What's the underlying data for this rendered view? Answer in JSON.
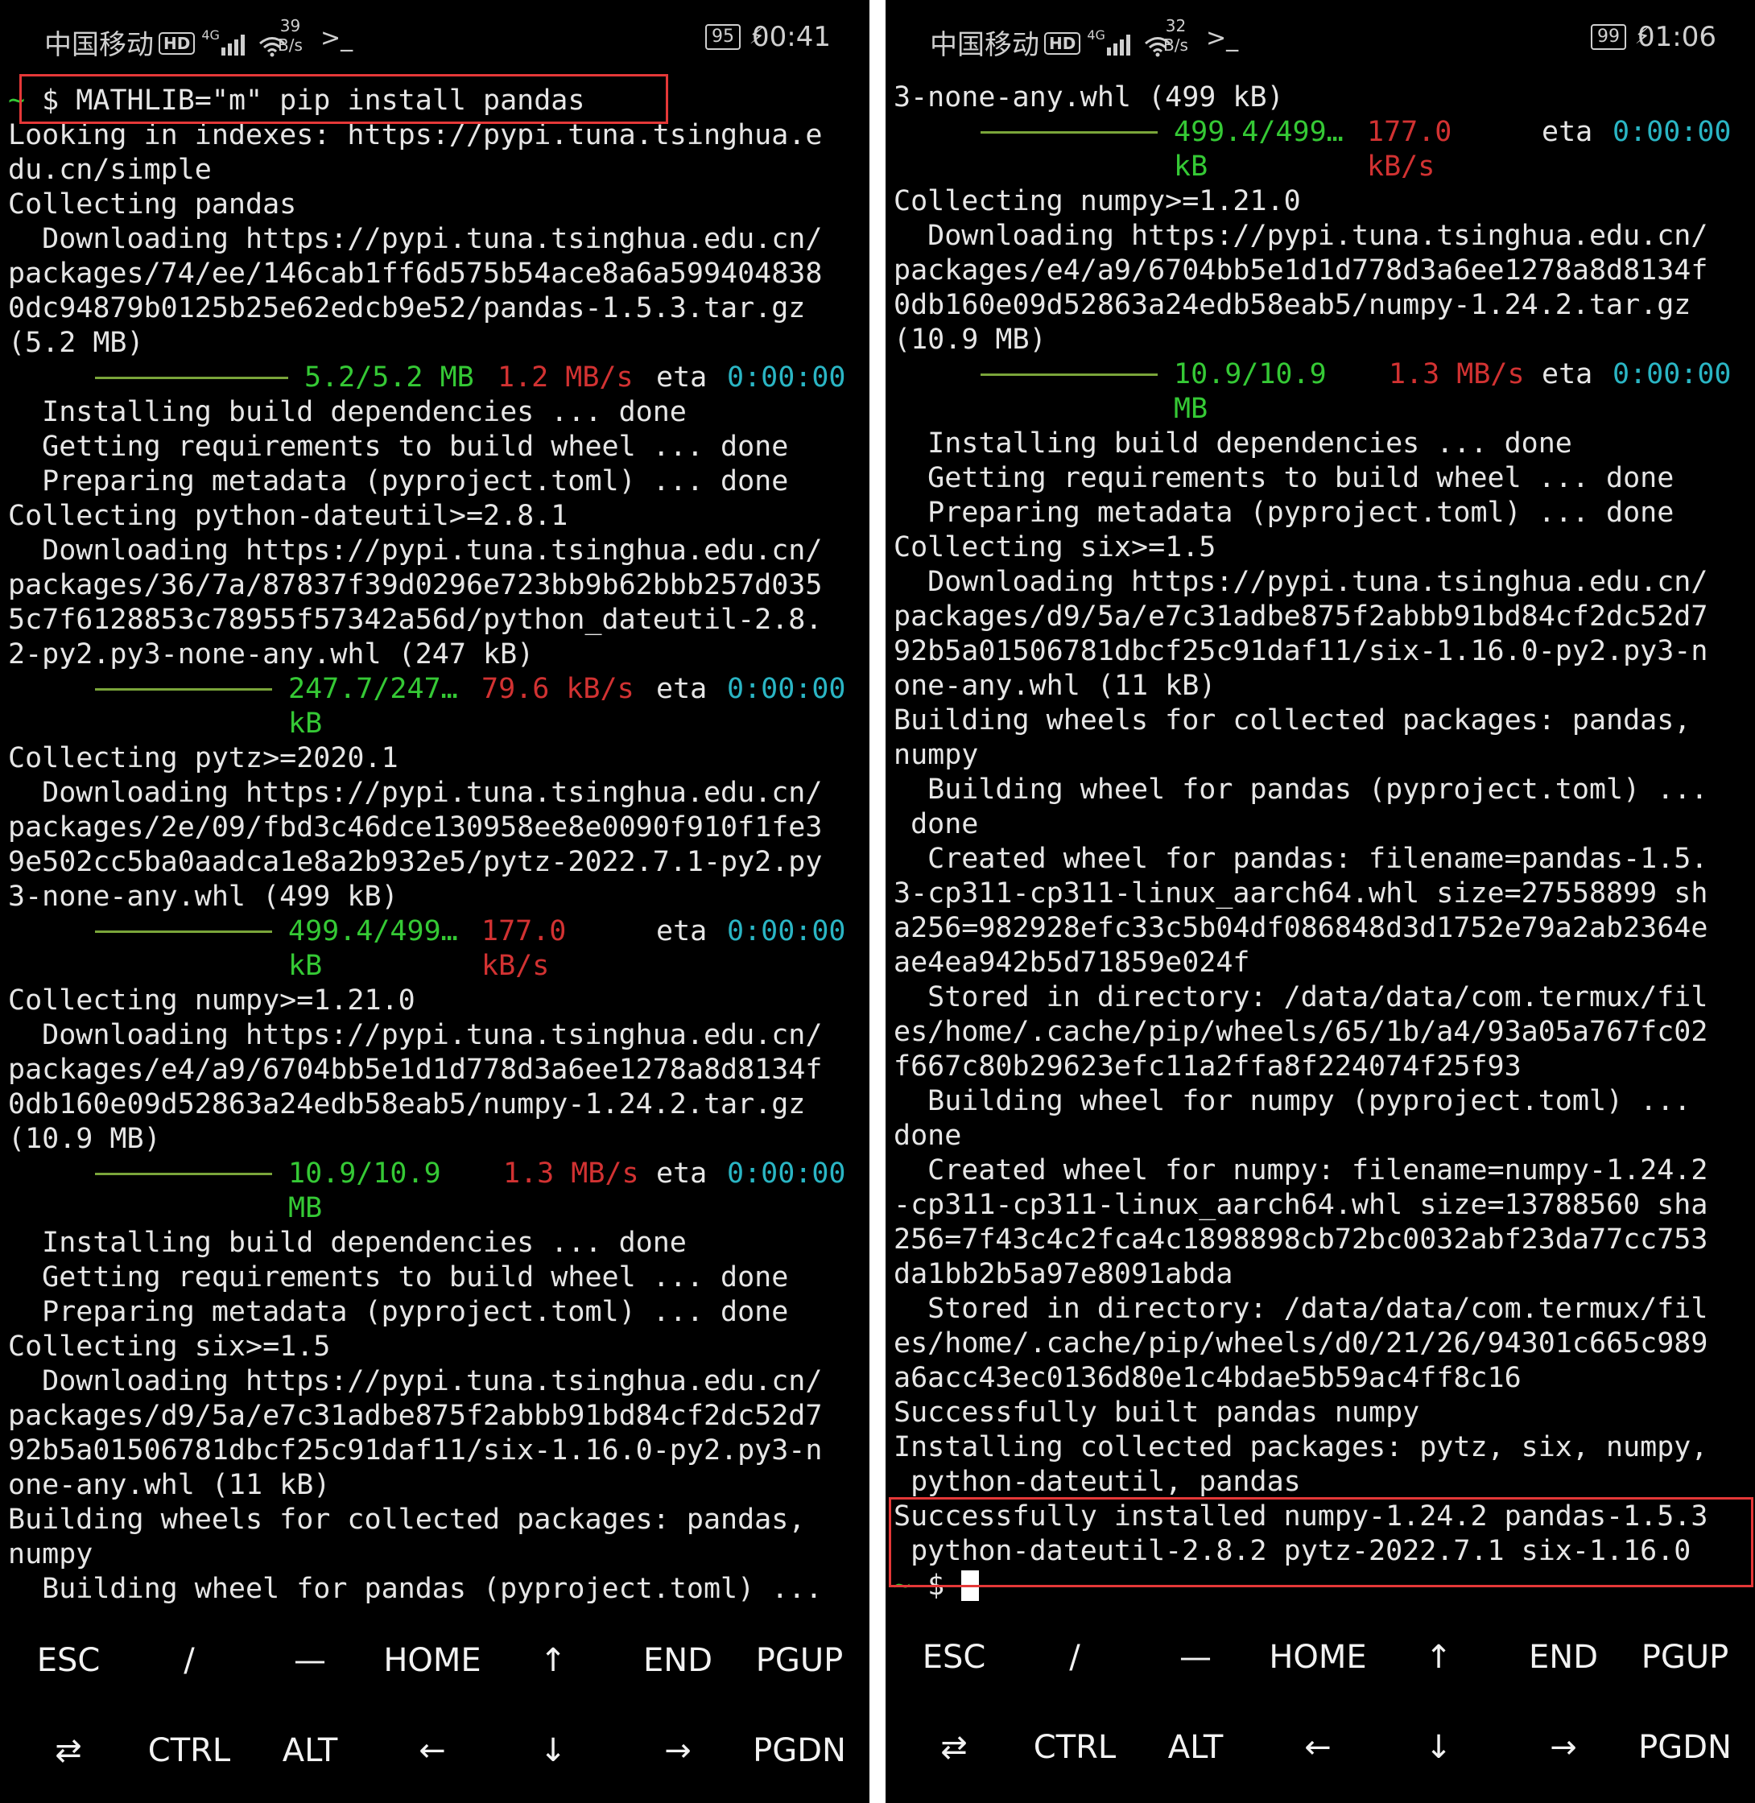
{
  "left": {
    "status": {
      "carrier": "中国移动",
      "hd": "HD",
      "signal": "4G",
      "speed_value": "39",
      "speed_unit": "B/s",
      "battery": "95",
      "time": "00:41"
    },
    "command": "$ MATHLIB=\"m\" pip install pandas",
    "prompt_tilde": "~",
    "lines": [
      "Looking in indexes: https://pypi.tuna.tsinghua.e",
      "du.cn/simple",
      "Collecting pandas",
      "  Downloading https://pypi.tuna.tsinghua.edu.cn/",
      "packages/74/ee/146cab1ff6d575b54ace8a6a599404838",
      "0dc94879b0125b25e62edcb9e52/pandas-1.5.3.tar.gz",
      "(5.2 MB)",
      "  Installing build dependencies ... done",
      "  Getting requirements to build wheel ... done",
      "  Preparing metadata (pyproject.toml) ... done",
      "Collecting python-dateutil>=2.8.1",
      "  Downloading https://pypi.tuna.tsinghua.edu.cn/",
      "packages/36/7a/87837f39d0296e723bb9b62bbb257d035",
      "5c7f6128853c78955f57342a56d/python_dateutil-2.8.",
      "2-py2.py3-none-any.whl (247 kB)",
      "Collecting pytz>=2020.1",
      "  Downloading https://pypi.tuna.tsinghua.edu.cn/",
      "packages/2e/09/fbd3c46dce130958ee8e0090f910f1fe3",
      "9e502cc5ba0aadca1e8a2b932e5/pytz-2022.7.1-py2.py",
      "3-none-any.whl (499 kB)",
      "Collecting numpy>=1.21.0",
      "  Downloading https://pypi.tuna.tsinghua.edu.cn/",
      "packages/e4/a9/6704bb5e1d1d778d3a6ee1278a8d8134f",
      "0db160e09d52863a24edb58eab5/numpy-1.24.2.tar.gz",
      "(10.9 MB)",
      "  Installing build dependencies ... done",
      "  Getting requirements to build wheel ... done",
      "  Preparing metadata (pyproject.toml) ... done",
      "Collecting six>=1.5",
      "  Downloading https://pypi.tuna.tsinghua.edu.cn/",
      "packages/d9/5a/e7c31adbe875f2abbb91bd84cf2dc52d7",
      "92b5a01506781dbcf25c91daf11/six-1.16.0-py2.py3-n",
      "one-any.whl (11 kB)",
      "Building wheels for collected packages: pandas,",
      "numpy",
      "  Building wheel for pandas (pyproject.toml) ..."
    ],
    "progress": [
      {
        "done": "5.2/5.2 MB",
        "rate": "1.2 MB/s",
        "eta_label": "eta",
        "eta": "0:00:00",
        "done2": "",
        "rate2": "",
        "fraction": 1.0
      },
      {
        "done": "247.7/247…",
        "rate": "79.6 kB/s",
        "eta_label": "eta",
        "eta": "0:00:00",
        "done2": "kB",
        "rate2": "",
        "fraction": 1.0
      },
      {
        "done": "499.4/499…",
        "rate": "177.0",
        "eta_label": "eta",
        "eta": "0:00:00",
        "done2": "kB",
        "rate2": "kB/s",
        "fraction": 1.0
      },
      {
        "done": "10.9/10.9",
        "rate": "1.3 MB/s",
        "eta_label": "eta",
        "eta": "0:00:00",
        "done2": "MB",
        "rate2": "",
        "fraction": 1.0
      }
    ]
  },
  "right": {
    "status": {
      "carrier": "中国移动",
      "hd": "HD",
      "signal": "4G",
      "speed_value": "32",
      "speed_unit": "B/s",
      "battery": "99",
      "time": "01:06"
    },
    "lines": [
      "3-none-any.whl (499 kB)",
      "Collecting numpy>=1.21.0",
      "  Downloading https://pypi.tuna.tsinghua.edu.cn/",
      "packages/e4/a9/6704bb5e1d1d778d3a6ee1278a8d8134f",
      "0db160e09d52863a24edb58eab5/numpy-1.24.2.tar.gz",
      "(10.9 MB)",
      "  Installing build dependencies ... done",
      "  Getting requirements to build wheel ... done",
      "  Preparing metadata (pyproject.toml) ... done",
      "Collecting six>=1.5",
      "  Downloading https://pypi.tuna.tsinghua.edu.cn/",
      "packages/d9/5a/e7c31adbe875f2abbb91bd84cf2dc52d7",
      "92b5a01506781dbcf25c91daf11/six-1.16.0-py2.py3-n",
      "one-any.whl (11 kB)",
      "Building wheels for collected packages: pandas,",
      "numpy",
      "  Building wheel for pandas (pyproject.toml) ...",
      " done",
      "  Created wheel for pandas: filename=pandas-1.5.",
      "3-cp311-cp311-linux_aarch64.whl size=27558899 sh",
      "a256=982928efc33c5b04df086848d3d1752e79a2ab2364e",
      "ae4ea942b5d71859e024f",
      "  Stored in directory: /data/data/com.termux/fil",
      "es/home/.cache/pip/wheels/65/1b/a4/93a05a767fc02",
      "f667c80b29623efc11a2ffa8f224074f25f93",
      "  Building wheel for numpy (pyproject.toml) ...",
      "done",
      "  Created wheel for numpy: filename=numpy-1.24.2",
      "-cp311-cp311-linux_aarch64.whl size=13788560 sha",
      "256=7f43c4c2fca4c1898898cb72bc0032abf23da77cc753",
      "da1bb2b5a97e8091abda",
      "  Stored in directory: /data/data/com.termux/fil",
      "es/home/.cache/pip/wheels/d0/21/26/94301c665c989",
      "a6acc43ec0136d80e1c4bdae5b59ac4ff8c16",
      "Successfully built pandas numpy",
      "Installing collected packages: pytz, six, numpy,",
      " python-dateutil, pandas",
      "Successfully installed numpy-1.24.2 pandas-1.5.3",
      " python-dateutil-2.8.2 pytz-2022.7.1 six-1.16.0"
    ],
    "progress": [
      {
        "done": "499.4/499…",
        "rate": "177.0",
        "eta_label": "eta",
        "eta": "0:00:00",
        "done2": "kB",
        "rate2": "kB/s",
        "fraction": 1.0
      },
      {
        "done": "10.9/10.9",
        "rate": "1.3 MB/s",
        "eta_label": "eta",
        "eta": "0:00:00",
        "done2": "MB",
        "rate2": "",
        "fraction": 1.0
      }
    ],
    "prompt_tilde": "~",
    "prompt": "$"
  },
  "keys": {
    "row1": [
      "ESC",
      "/",
      "—",
      "HOME",
      "↑",
      "END",
      "PGUP"
    ],
    "row2": [
      "⇄",
      "CTRL",
      "ALT",
      "←",
      "↓",
      "→",
      "PGDN"
    ]
  },
  "colors": {
    "green": "#35c935",
    "red": "#d23232",
    "cyan": "#2ab5c4",
    "highlight": "#e53838",
    "bar": "#7aa53a"
  }
}
